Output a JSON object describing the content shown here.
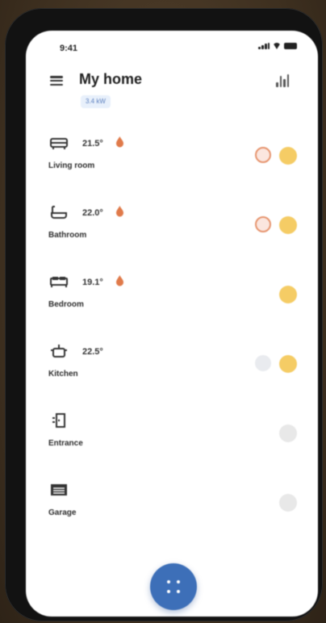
{
  "status_bar": {
    "time": "9:41"
  },
  "header": {
    "title": "My home",
    "subtitle": "3.4 kW"
  },
  "rooms": [
    {
      "name": "Living room",
      "temperature": "21.5°",
      "icon": "sofa-icon",
      "heating": true,
      "actions": [
        "fire-alert-icon",
        "light-bulb-icon"
      ]
    },
    {
      "name": "Bathroom",
      "temperature": "22.0°",
      "icon": "bathtub-icon",
      "heating": true,
      "actions": [
        "fire-alert-icon",
        "light-bulb-icon"
      ]
    },
    {
      "name": "Bedroom",
      "temperature": "19.1°",
      "icon": "bed-icon",
      "heating": true,
      "actions": [
        "light-bulb-icon"
      ]
    },
    {
      "name": "Kitchen",
      "temperature": "22.5°",
      "icon": "cooking-pot-icon",
      "heating": false,
      "actions": [
        "device-icon",
        "light-bulb-icon"
      ]
    },
    {
      "name": "Entrance",
      "temperature": "",
      "icon": "door-icon",
      "heating": false,
      "actions": [
        "light-bulb-icon"
      ]
    },
    {
      "name": "Garage",
      "temperature": "",
      "icon": "garage-icon",
      "heating": false,
      "actions": [
        "light-bulb-icon"
      ]
    }
  ],
  "colors": {
    "accent": "#3d6fb8",
    "heating": "#e07a4a",
    "light_on": "#f3c34a",
    "light_off": "#d9d9d9",
    "alert_bg": "#fbe1d8"
  }
}
